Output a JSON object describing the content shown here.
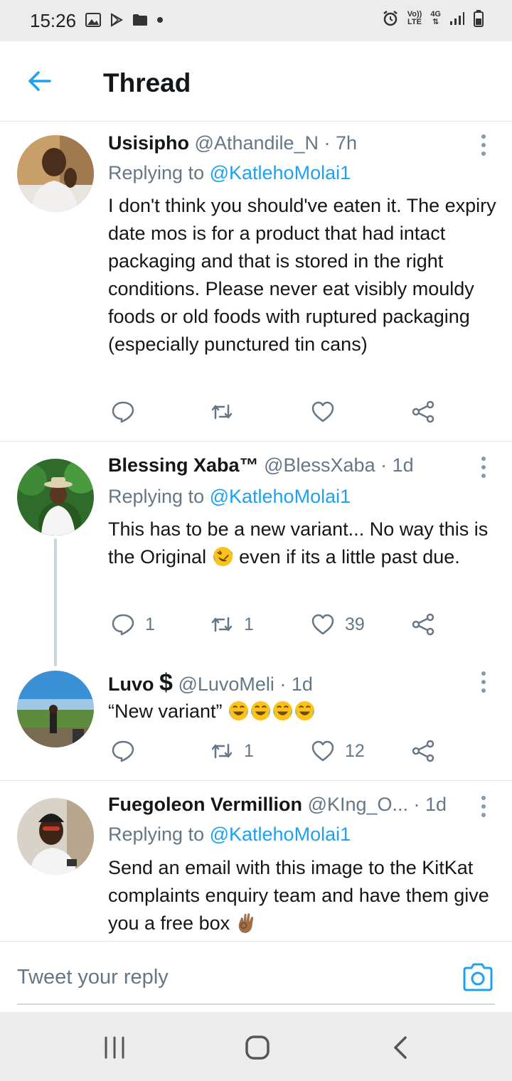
{
  "status_bar": {
    "time": "15:26",
    "network": "4G",
    "volte": "Vo)) LTE"
  },
  "header": {
    "title": "Thread"
  },
  "tweets": [
    {
      "name": "Usisipho",
      "handle": "@Athandile_N · 7h",
      "replying_prefix": "Replying to ",
      "replying_to": "@KatlehoMolai1",
      "text": "I don't think you should've eaten it. The expiry date mos is for a product that had intact packaging and that is stored in the right conditions. Please never eat visibly mouldy foods or old foods with ruptured packaging (especially punctured tin cans)",
      "replies": "",
      "retweets": "",
      "likes": ""
    },
    {
      "name": "Blessing Xaba™",
      "handle": "@BlessXaba · 1d",
      "replying_prefix": "Replying to ",
      "replying_to": "@KatlehoMolai1",
      "text_a": "This has to be a new variant... No way this is the Original",
      "text_b": " even if its a little past due.",
      "replies": "1",
      "retweets": "1",
      "likes": "39"
    },
    {
      "name": "Luvo",
      "name_symbol": "$",
      "handle": "@LuvoMeli · 1d",
      "text": "“New variant”",
      "replies": "",
      "retweets": "1",
      "likes": "12"
    },
    {
      "name": "Fuegoleon Vermillion",
      "handle": "@KIng_O... · 1d",
      "replying_prefix": "Replying to ",
      "replying_to": "@KatlehoMolai1",
      "text": "Send an email with this image to the KitKat complaints enquiry team and have them give you a free box"
    }
  ],
  "reply_bar": {
    "placeholder": "Tweet your reply"
  },
  "colors": {
    "accent": "#1da1f2",
    "muted": "#657786",
    "text": "#14171a",
    "divider": "#e1e8ed"
  },
  "icons": [
    "back-arrow-icon",
    "more-icon",
    "reply-icon",
    "retweet-icon",
    "like-icon",
    "share-icon",
    "camera-icon",
    "recents-icon",
    "home-icon",
    "back-nav-icon",
    "laughing-emoji-icon",
    "rolling-laughing-emoji-icon",
    "ok-hand-emoji-icon"
  ]
}
